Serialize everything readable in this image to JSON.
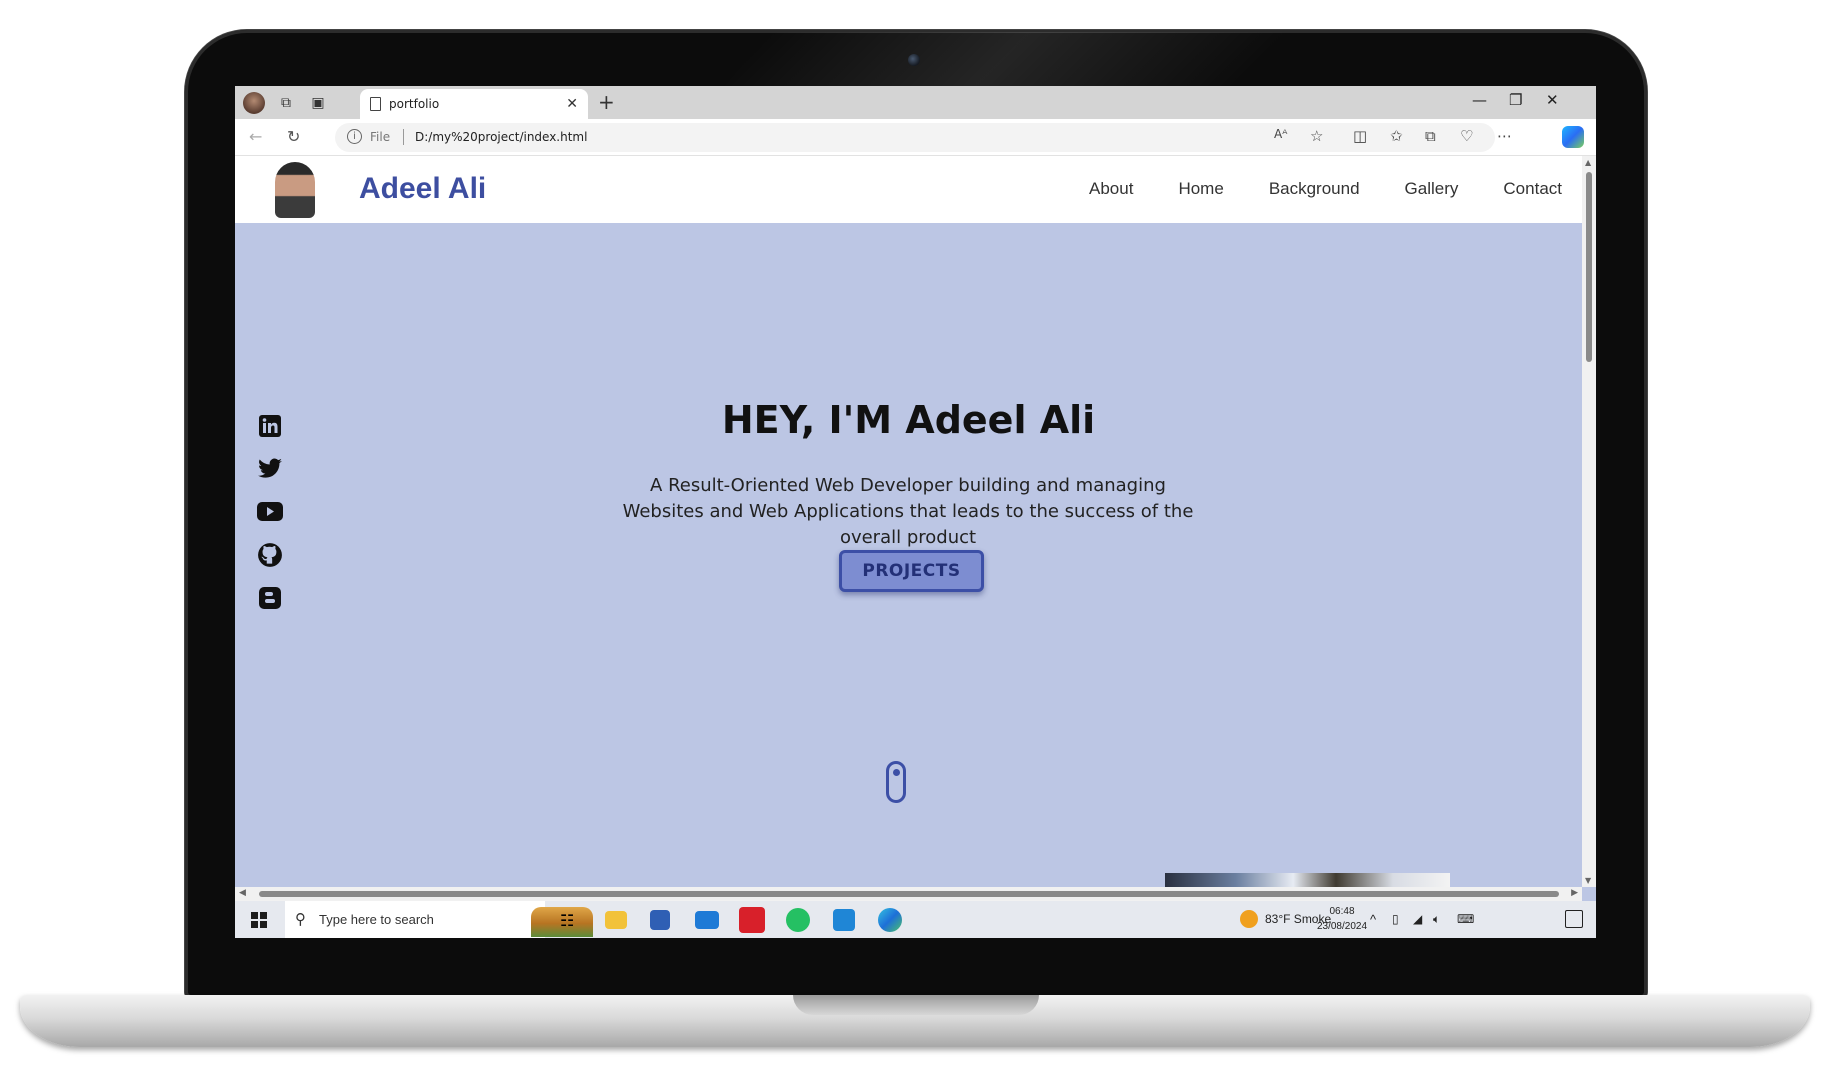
{
  "browser": {
    "tab_title": "portfolio",
    "url_scheme_label": "File",
    "url": "D:/my%20project/index.html",
    "read_aloud_label": "Aᴬ"
  },
  "site": {
    "brand": "Adeel Ali",
    "nav": [
      "About",
      "Home",
      "Background",
      "Gallery",
      "Contact"
    ],
    "hero": {
      "title": "HEY, I'M Adeel Ali",
      "subtitle": "A Result-Oriented Web Developer building and managing Websites and Web Applications that leads to the success of the overall product",
      "cta": "PROJECTS"
    },
    "social_icons": [
      "linkedin-icon",
      "twitter-icon",
      "youtube-icon",
      "github-icon",
      "blogger-icon"
    ]
  },
  "taskbar": {
    "search_placeholder": "Type here to search",
    "weather": "83°F  Smoke",
    "time": "06:48",
    "date": "23/08/2024"
  },
  "colors": {
    "hero_bg": "#bcc6e4",
    "brand": "#3d4ea0",
    "button_bg": "#7d8dd1",
    "button_border": "#3c4fa6"
  }
}
